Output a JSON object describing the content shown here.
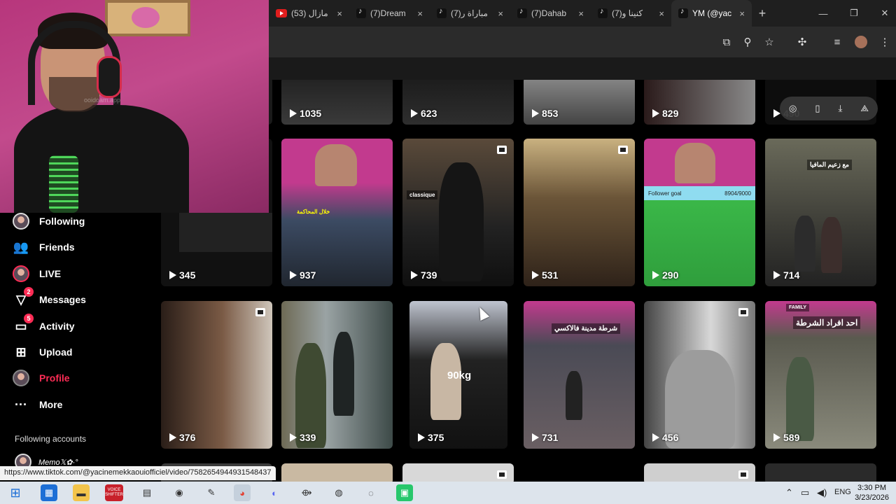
{
  "browser": {
    "tabs": [
      {
        "icon": "youtube-icon",
        "title": "(53) مازال"
      },
      {
        "icon": "tiktok-icon",
        "title": "(7)Dream"
      },
      {
        "icon": "tiktok-icon",
        "title": "(7)مباراة ر"
      },
      {
        "icon": "tiktok-icon",
        "title": "(7)Dahab"
      },
      {
        "icon": "tiktok-icon",
        "title": "(7)كنينا و"
      },
      {
        "icon": "tiktok-icon",
        "title": "YM (@yac"
      }
    ],
    "active_tab_index": 5,
    "close_glyph": "×",
    "new_tab_glyph": "+",
    "minimize_glyph": "—",
    "maximize_glyph": "❐",
    "window_close_glyph": "✕"
  },
  "sidebar": {
    "items": [
      {
        "label": "Following",
        "icon": "avatar-icon"
      },
      {
        "label": "Friends",
        "icon": "friends-icon"
      },
      {
        "label": "LIVE",
        "icon": "live-icon"
      },
      {
        "label": "Messages",
        "icon": "messages-icon",
        "badge": "2"
      },
      {
        "label": "Activity",
        "icon": "activity-icon",
        "badge": "5"
      },
      {
        "label": "Upload",
        "icon": "upload-icon"
      },
      {
        "label": "Profile",
        "icon": "profile-icon",
        "active": true
      },
      {
        "label": "More",
        "icon": "more-icon"
      }
    ],
    "following_accounts": "Following accounts",
    "account_name": "Memo𝕏✿·°"
  },
  "videos": {
    "row0": [
      "1035",
      "623",
      "853",
      "829",
      "490"
    ],
    "row1": [
      "345",
      "937",
      "739",
      "531",
      "290",
      "714"
    ],
    "row2": [
      "376",
      "339",
      "375",
      "731",
      "456",
      "589"
    ],
    "captions": {
      "r1c1": "خلال المحاكمة",
      "r1c2": "classique",
      "r1c4_goal": "Follower goal",
      "r1c4_count": "8904/9000",
      "r1c5": "مع زعيم المافيا",
      "r2c2": "90kg",
      "r2c3": "شرطة مدينة فالاكسي",
      "r2c5": "احد افراد الشرطة",
      "r2c5_top": "FAMILY"
    }
  },
  "webcam": {
    "watermark": "ooidoam.app"
  },
  "status_url": "https://www.tiktok.com/@yacinemekkaouiofficiel/video/7582654944931548437",
  "taskbar": {
    "language": "ENG",
    "time": "3:30 PM",
    "date": "3/23/2026",
    "voice_label": "VOICE\nSHIFTER"
  },
  "colors": {
    "accent": "#fe2c55",
    "background": "#000000",
    "tabbar": "#1f1f1f",
    "toolbar": "#2b2b2b"
  }
}
